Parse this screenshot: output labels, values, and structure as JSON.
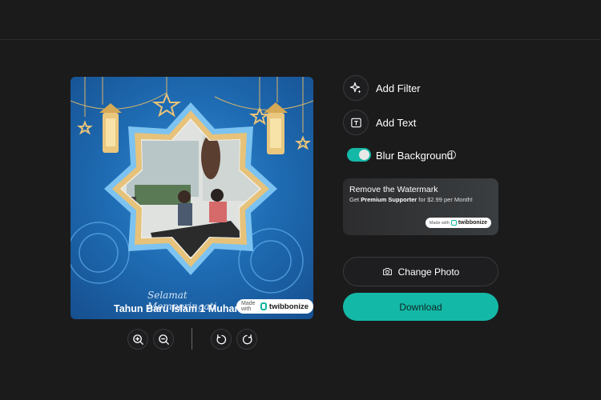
{
  "photo": {
    "caption_script": "Selamat Memperingati",
    "caption_main": "Tahun Baru Islam 1 Muharram",
    "watermark_prefix": "Made with",
    "watermark_brand": "twibbonize"
  },
  "controls": {
    "zoom_in": "zoom-in-icon",
    "zoom_out": "zoom-out-icon",
    "rotate_left": "rotate-left-icon",
    "rotate_right": "rotate-right-icon"
  },
  "options": {
    "add_filter": "Add Filter",
    "add_text": "Add Text",
    "blur_background": "Blur Background",
    "blur_enabled": true,
    "info": "i"
  },
  "promo": {
    "title": "Remove the Watermark",
    "sub_prefix": "Get ",
    "sub_bold": "Premium Supporter",
    "sub_suffix": " for $2.99 per Month!",
    "badge_prefix": "Made with",
    "badge_brand": "twibbonize"
  },
  "buttons": {
    "change_photo": "Change Photo",
    "download": "Download"
  },
  "colors": {
    "accent": "#14b8a6",
    "background": "#1b1b1c"
  }
}
